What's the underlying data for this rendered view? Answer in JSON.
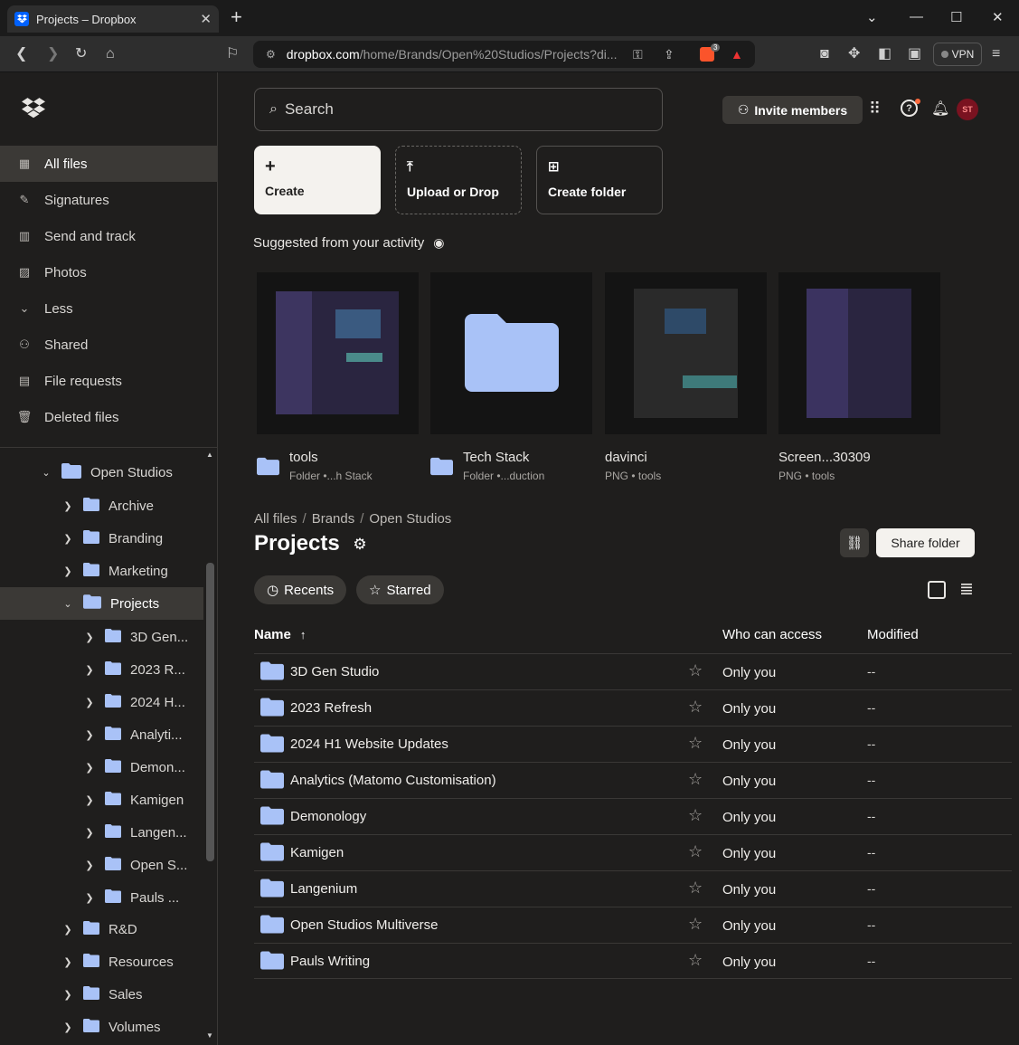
{
  "browser": {
    "tab_title": "Projects – Dropbox",
    "url_host": "dropbox.com",
    "url_path": "/home/Brands/Open%20Studios/Projects?di...",
    "vpn_label": "VPN",
    "brave_badge": "3"
  },
  "sidebar": {
    "nav": [
      {
        "label": "All files",
        "icon": "files-icon"
      },
      {
        "label": "Signatures",
        "icon": "signature-icon"
      },
      {
        "label": "Send and track",
        "icon": "chart-icon"
      },
      {
        "label": "Photos",
        "icon": "photo-icon"
      },
      {
        "label": "Less",
        "icon": "chevron-down-icon"
      },
      {
        "label": "Shared",
        "icon": "people-icon"
      },
      {
        "label": "File requests",
        "icon": "file-request-icon"
      },
      {
        "label": "Deleted files",
        "icon": "trash-icon"
      }
    ],
    "tree": [
      {
        "label": "Open Studios"
      },
      {
        "label": "Archive"
      },
      {
        "label": "Branding"
      },
      {
        "label": "Marketing"
      },
      {
        "label": "Projects"
      },
      {
        "label": "3D Gen..."
      },
      {
        "label": "2023 R..."
      },
      {
        "label": "2024 H..."
      },
      {
        "label": "Analyti..."
      },
      {
        "label": "Demon..."
      },
      {
        "label": "Kamigen"
      },
      {
        "label": "Langen..."
      },
      {
        "label": "Open S..."
      },
      {
        "label": "Pauls ..."
      },
      {
        "label": "R&D"
      },
      {
        "label": "Resources"
      },
      {
        "label": "Sales"
      },
      {
        "label": "Volumes"
      }
    ]
  },
  "header": {
    "search_placeholder": "Search",
    "invite_label": "Invite members",
    "avatar_initials": "ST"
  },
  "actions": {
    "create": "Create",
    "upload": "Upload or Drop",
    "create_folder": "Create folder"
  },
  "suggested": {
    "title": "Suggested from your activity",
    "items": [
      {
        "name": "tools",
        "sub": "Folder •...h Stack"
      },
      {
        "name": "Tech Stack",
        "sub": "Folder •...duction"
      },
      {
        "name": "davinci",
        "sub": "PNG • tools"
      },
      {
        "name": "Screen...30309",
        "sub": "PNG • tools"
      }
    ]
  },
  "breadcrumb": [
    "All files",
    "Brands",
    "Open Studios"
  ],
  "page_title": "Projects",
  "share_folder_label": "Share folder",
  "filters": {
    "recents": "Recents",
    "starred": "Starred"
  },
  "table": {
    "headers": {
      "name": "Name",
      "access": "Who can access",
      "modified": "Modified"
    },
    "rows": [
      {
        "name": "3D Gen Studio",
        "access": "Only you",
        "modified": "--"
      },
      {
        "name": "2023 Refresh",
        "access": "Only you",
        "modified": "--"
      },
      {
        "name": "2024 H1 Website Updates",
        "access": "Only you",
        "modified": "--"
      },
      {
        "name": "Analytics (Matomo Customisation)",
        "access": "Only you",
        "modified": "--"
      },
      {
        "name": "Demonology",
        "access": "Only you",
        "modified": "--"
      },
      {
        "name": "Kamigen",
        "access": "Only you",
        "modified": "--"
      },
      {
        "name": "Langenium",
        "access": "Only you",
        "modified": "--"
      },
      {
        "name": "Open Studios Multiverse",
        "access": "Only you",
        "modified": "--"
      },
      {
        "name": "Pauls Writing",
        "access": "Only you",
        "modified": "--"
      }
    ]
  },
  "colors": {
    "folder": "#a9c2f7",
    "accent": "#0061fe",
    "background": "#1f1e1d"
  }
}
